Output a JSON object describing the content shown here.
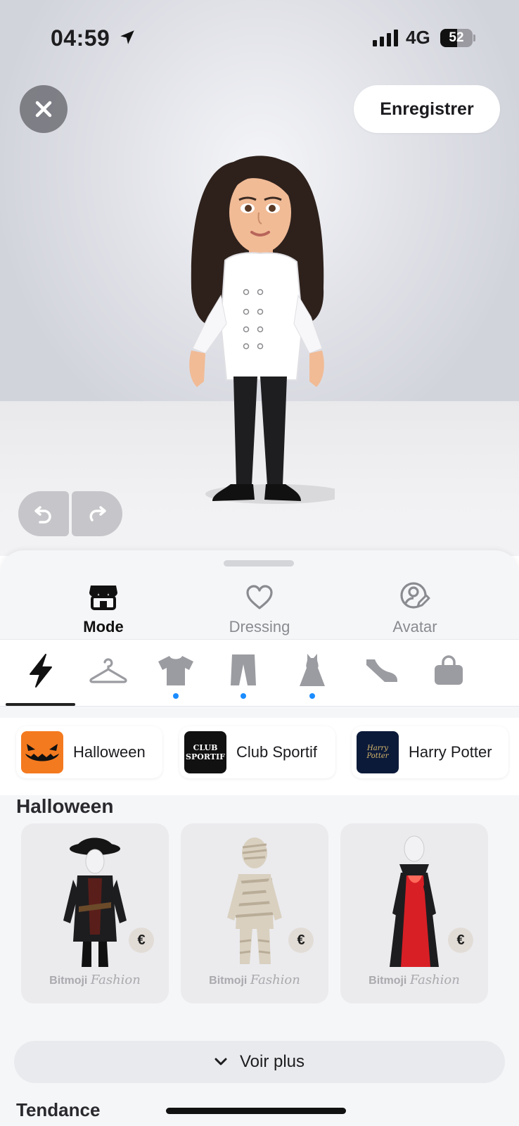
{
  "status": {
    "time": "04:59",
    "network": "4G",
    "battery": "52",
    "battery_level": 0.52,
    "signal_bars": 4
  },
  "header": {
    "save_label": "Enregistrer"
  },
  "main_tabs": [
    {
      "label": "Mode",
      "icon": "store-icon",
      "active": true
    },
    {
      "label": "Dressing",
      "icon": "heart-icon",
      "active": false
    },
    {
      "label": "Avatar",
      "icon": "avatar-edit-icon",
      "active": false
    }
  ],
  "category_icons": [
    {
      "icon": "lightning-icon",
      "active": true,
      "dot": false
    },
    {
      "icon": "hanger-icon",
      "active": false,
      "dot": false
    },
    {
      "icon": "tshirt-icon",
      "active": false,
      "dot": true
    },
    {
      "icon": "pants-icon",
      "active": false,
      "dot": true
    },
    {
      "icon": "dress-icon",
      "active": false,
      "dot": true
    },
    {
      "icon": "shoe-icon",
      "active": false,
      "dot": false
    },
    {
      "icon": "bag-icon",
      "active": false,
      "dot": false
    }
  ],
  "collections": [
    {
      "label": "Halloween",
      "thumb_color": "#f47a1f"
    },
    {
      "label": "Club Sportif",
      "thumb_text": "CLUB SPORTIF",
      "thumb_color": "#111111"
    },
    {
      "label": "Harry Potter",
      "thumb_text": "Harry Potter",
      "thumb_color": "#0c1a3a"
    }
  ],
  "section": {
    "title": "Halloween"
  },
  "outfits": [
    {
      "name": "pirate",
      "price_icon": "€",
      "brand": "Bitmoji",
      "brand_script": "Fashion"
    },
    {
      "name": "mummy",
      "price_icon": "€",
      "brand": "Bitmoji",
      "brand_script": "Fashion"
    },
    {
      "name": "vampire",
      "price_icon": "€",
      "brand": "Bitmoji",
      "brand_script": "Fashion"
    }
  ],
  "more_label": "Voir plus",
  "next_section": "Tendance"
}
